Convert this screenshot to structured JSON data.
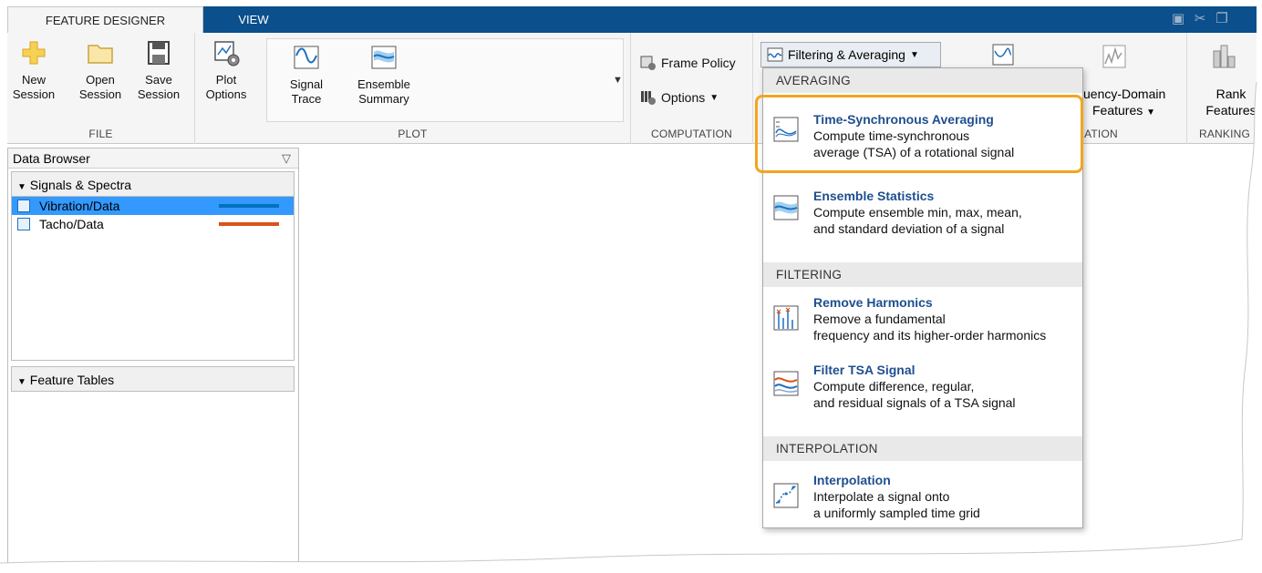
{
  "tabs": {
    "feature_designer": "FEATURE DESIGNER",
    "view": "VIEW"
  },
  "ribbon": {
    "file": {
      "label": "FILE",
      "new_l1": "New",
      "new_l2": "Session",
      "open_l1": "Open",
      "open_l2": "Session",
      "save_l1": "Save",
      "save_l2": "Session"
    },
    "plot": {
      "label": "PLOT",
      "options_l1": "Plot",
      "options_l2": "Options",
      "signal_l1": "Signal",
      "signal_l2": "Trace",
      "ensemble_l1": "Ensemble",
      "ensemble_l2": "Summary"
    },
    "computation": {
      "label": "COMPUTATION",
      "frame_policy": "Frame Policy",
      "options": "Options"
    },
    "filtering_button": "Filtering & Averaging",
    "generation": {
      "label_partial": "ERATION",
      "freq_l1": "uency-Domain",
      "freq_l2": "Features"
    },
    "ranking": {
      "label": "RANKING",
      "rank_l1": "Rank",
      "rank_l2": "Features"
    }
  },
  "data_browser": {
    "title": "Data Browser",
    "signals_header": "Signals & Spectra",
    "signals": [
      {
        "name": "Vibration/Data",
        "color": "#0072bd"
      },
      {
        "name": "Tacho/Data",
        "color": "#d95319"
      }
    ],
    "feature_tables_header": "Feature Tables"
  },
  "menu": {
    "averaging": "AVERAGING",
    "tsa_title": "Time-Synchronous Averaging",
    "tsa_d1": "Compute time-synchronous",
    "tsa_d2": "average (TSA) of a rotational signal",
    "ens_title": "Ensemble Statistics",
    "ens_d1": "Compute ensemble min, max, mean,",
    "ens_d2": "and standard deviation of a signal",
    "filtering": "FILTERING",
    "rh_title": "Remove Harmonics",
    "rh_d1": "Remove a fundamental",
    "rh_d2": "frequency and its higher-order harmonics",
    "ft_title": "Filter TSA Signal",
    "ft_d1": "Compute difference, regular,",
    "ft_d2": "and residual signals of a TSA signal",
    "interpolation": "INTERPOLATION",
    "in_title": "Interpolation",
    "in_d1": "Interpolate a signal onto",
    "in_d2": "a uniformly sampled time grid"
  },
  "colors": {
    "tabbar": "#0b4f8c",
    "highlight": "#f2a51e",
    "menu_title": "#1e4f8f",
    "selection": "#3399ff"
  }
}
